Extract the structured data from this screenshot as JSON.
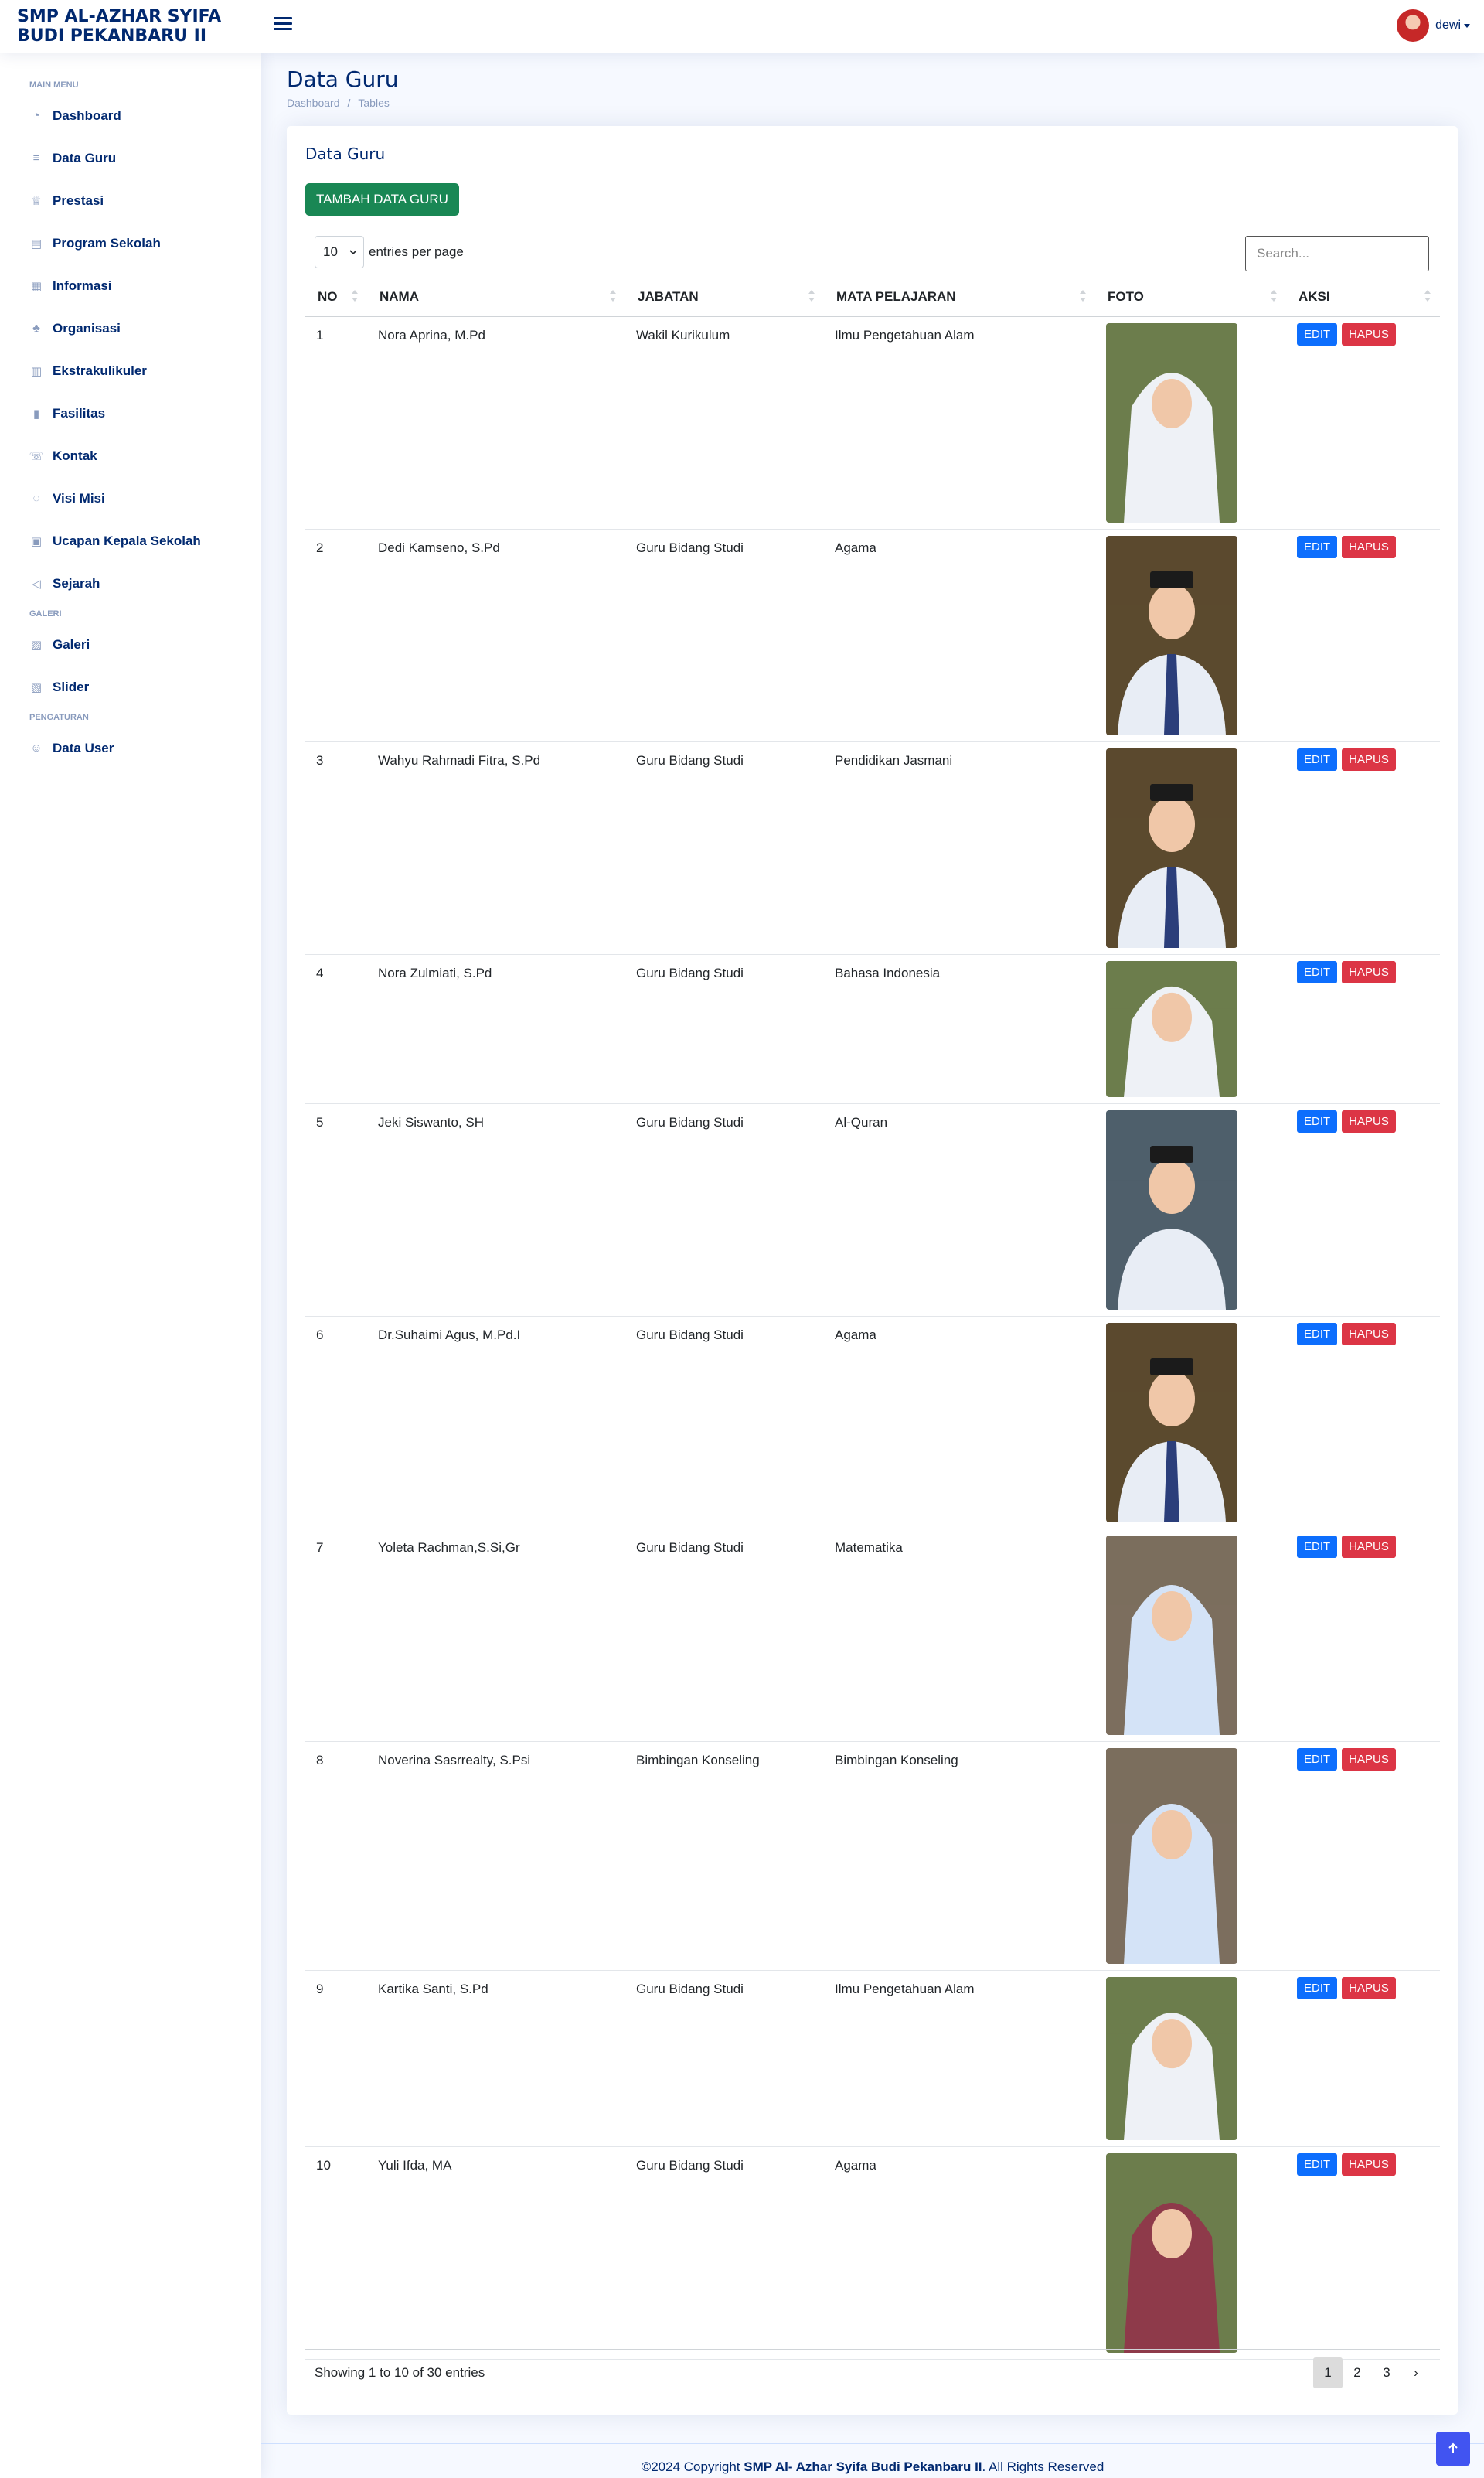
{
  "header": {
    "logo_line1": "SMP AL-AZHAR SYIFA",
    "logo_line2": "BUDI PEKANBARU II",
    "user_name": "dewi"
  },
  "sidebar": {
    "main_heading": "MAIN MENU",
    "main_items": [
      {
        "label": "Dashboard",
        "icon": "dashboard-icon"
      },
      {
        "label": "Data Guru",
        "icon": "database-icon"
      },
      {
        "label": "Prestasi",
        "icon": "trophy-icon"
      },
      {
        "label": "Program Sekolah",
        "icon": "building-icon"
      },
      {
        "label": "Informasi",
        "icon": "newspaper-icon"
      },
      {
        "label": "Organisasi",
        "icon": "diagram-icon"
      },
      {
        "label": "Ekstrakulikuler",
        "icon": "calculator-icon"
      },
      {
        "label": "Fasilitas",
        "icon": "bar-chart-icon"
      },
      {
        "label": "Kontak",
        "icon": "telephone-icon"
      },
      {
        "label": "Visi Misi",
        "icon": "lightbulb-icon"
      },
      {
        "label": "Ucapan Kepala Sekolah",
        "icon": "person-badge-icon"
      },
      {
        "label": "Sejarah",
        "icon": "megaphone-icon"
      }
    ],
    "gallery_heading": "GALERI",
    "gallery_items": [
      {
        "label": "Galeri",
        "icon": "image-icon"
      },
      {
        "label": "Slider",
        "icon": "images-icon"
      }
    ],
    "settings_heading": "PENGATURAN",
    "settings_items": [
      {
        "label": "Data User",
        "icon": "person-icon"
      }
    ]
  },
  "page": {
    "title": "Data Guru",
    "breadcrumb_home": "Dashboard",
    "breadcrumb_sep": "/",
    "breadcrumb_current": "Tables"
  },
  "card": {
    "title": "Data Guru",
    "add_button": "TAMBAH DATA GURU",
    "per_page_value": "10",
    "per_page_label": "entries per page",
    "search_placeholder": "Search...",
    "columns": [
      "NO",
      "NAMA",
      "JABATAN",
      "MATA PELAJARAN",
      "FOTO",
      "AKSI"
    ],
    "edit_label": "EDIT",
    "delete_label": "HAPUS",
    "rows": [
      {
        "no": "1",
        "nama": "Nora Aprina, M.Pd",
        "jabatan": "Wakil Kurikulum",
        "mapel": "Ilmu Pengetahuan Alam",
        "photo": "woman-hijab-white"
      },
      {
        "no": "2",
        "nama": "Dedi Kamseno, S.Pd",
        "jabatan": "Guru Bidang Studi",
        "mapel": "Agama",
        "photo": "man-peci-tie"
      },
      {
        "no": "3",
        "nama": "Wahyu Rahmadi Fitra, S.Pd",
        "jabatan": "Guru Bidang Studi",
        "mapel": "Pendidikan Jasmani",
        "photo": "man-peci-tie"
      },
      {
        "no": "4",
        "nama": "Nora Zulmiati, S.Pd",
        "jabatan": "Guru Bidang Studi",
        "mapel": "Bahasa Indonesia",
        "photo": "woman-hijab-white"
      },
      {
        "no": "5",
        "nama": "Jeki Siswanto, SH",
        "jabatan": "Guru Bidang Studi",
        "mapel": "Al-Quran",
        "photo": "man-peci-shirt"
      },
      {
        "no": "6",
        "nama": "Dr.Suhaimi Agus, M.Pd.I",
        "jabatan": "Guru Bidang Studi",
        "mapel": "Agama",
        "photo": "man-peci-tie"
      },
      {
        "no": "7",
        "nama": "Yoleta Rachman,S.Si,Gr",
        "jabatan": "Guru Bidang Studi",
        "mapel": "Matematika",
        "photo": "woman-hijab-blue"
      },
      {
        "no": "8",
        "nama": "Noverina Sasrrealty, S.Psi",
        "jabatan": "Bimbingan Konseling",
        "mapel": "Bimbingan Konseling",
        "photo": "woman-hijab-blue"
      },
      {
        "no": "9",
        "nama": "Kartika Santi, S.Pd",
        "jabatan": "Guru Bidang Studi",
        "mapel": "Ilmu Pengetahuan Alam",
        "photo": "woman-hijab-white"
      },
      {
        "no": "10",
        "nama": "Yuli Ifda, MA",
        "jabatan": "Guru Bidang Studi",
        "mapel": "Agama",
        "photo": "woman-hijab-maroon"
      }
    ],
    "info": "Showing 1 to 10 of 30 entries",
    "pages": [
      "1",
      "2",
      "3",
      "›"
    ]
  },
  "footer": {
    "prefix": "©2024 Copyright ",
    "brand": "SMP Al- Azhar Syifa Budi Pekanbaru II",
    "suffix": ". All Rights Reserved"
  },
  "colors": {
    "navy": "#012970",
    "green": "#198754",
    "blue": "#0d6efd",
    "red": "#dc3545",
    "backtop": "#4154f1"
  }
}
